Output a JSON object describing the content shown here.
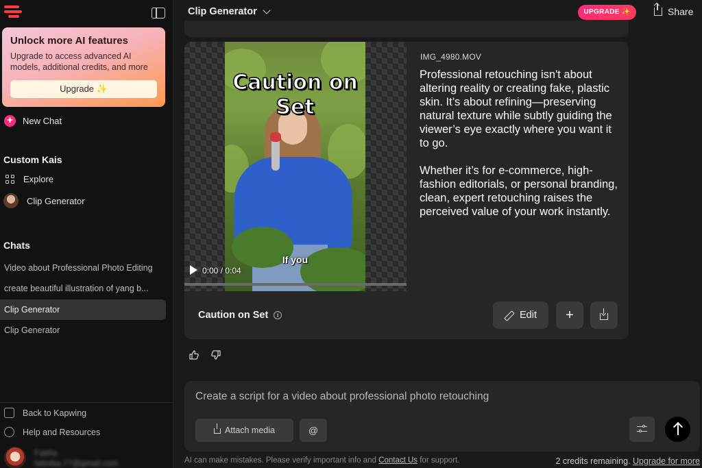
{
  "sidebar": {
    "promo": {
      "title": "Unlock more AI features",
      "description": "Upgrade to access advanced AI models, additional credits, and more",
      "button_label": "Upgrade",
      "button_sparkle": "✨"
    },
    "new_chat_label": "New Chat",
    "custom_kais_title": "Custom Kais",
    "custom_items": [
      {
        "label": "Explore",
        "icon": "grid-icon"
      },
      {
        "label": "Clip Generator",
        "icon": "avatar"
      }
    ],
    "chats_title": "Chats",
    "chats": [
      {
        "label": "Video about Professional Photo Editing",
        "active": false
      },
      {
        "label": "create beautiful illustration of yang b...",
        "active": false
      },
      {
        "label": "Clip Generator",
        "active": true
      },
      {
        "label": "Clip Generator",
        "active": false
      }
    ],
    "footer": {
      "back_label": "Back to Kapwing",
      "help_label": "Help and Resources",
      "user_name": "Fatiha",
      "user_email": "fatiniba.77@gmail.com"
    }
  },
  "topbar": {
    "title": "Clip Generator",
    "upgrade_label": "UPGRADE",
    "upgrade_sparkle": "✨",
    "share_label": "Share"
  },
  "media_card": {
    "file_name": "IMG_4980.MOV",
    "caption_big": "Caution on Set",
    "caption_small": "If you",
    "time": "0:00 / 0:04",
    "progress_fraction": 0.0,
    "description": [
      "Professional retouching isn't about altering reality or creating fake, plastic skin. It’s about refining—preserving natural texture while subtly guiding the viewer’s eye exactly where you want it to go.",
      "Whether it’s for e-commerce, high-fashion editorials, or personal branding, clean, expert retouching raises the perceived value of your work instantly."
    ],
    "title": "Caution on Set",
    "edit_label": "Edit",
    "plus_label": "+"
  },
  "feedback": {
    "like_icon": "thumbs-up-icon",
    "dislike_icon": "thumbs-down-icon"
  },
  "composer": {
    "placeholder": "Create a script for a video about professional photo retouching",
    "attach_label": "Attach media",
    "at_label": "@"
  },
  "footer_bar": {
    "disclaimer_prefix": "AI can make mistakes. Please verify important info and ",
    "contact_link": "Contact Us",
    "disclaimer_suffix": " for support.",
    "credits_text": "2 credits remaining.",
    "upgrade_link": "Upgrade for more"
  },
  "colors": {
    "accent_pink": "#ff2b7a",
    "logo_red": "#ff3b3b",
    "background": "#1a1a1a",
    "card": "#262626"
  }
}
